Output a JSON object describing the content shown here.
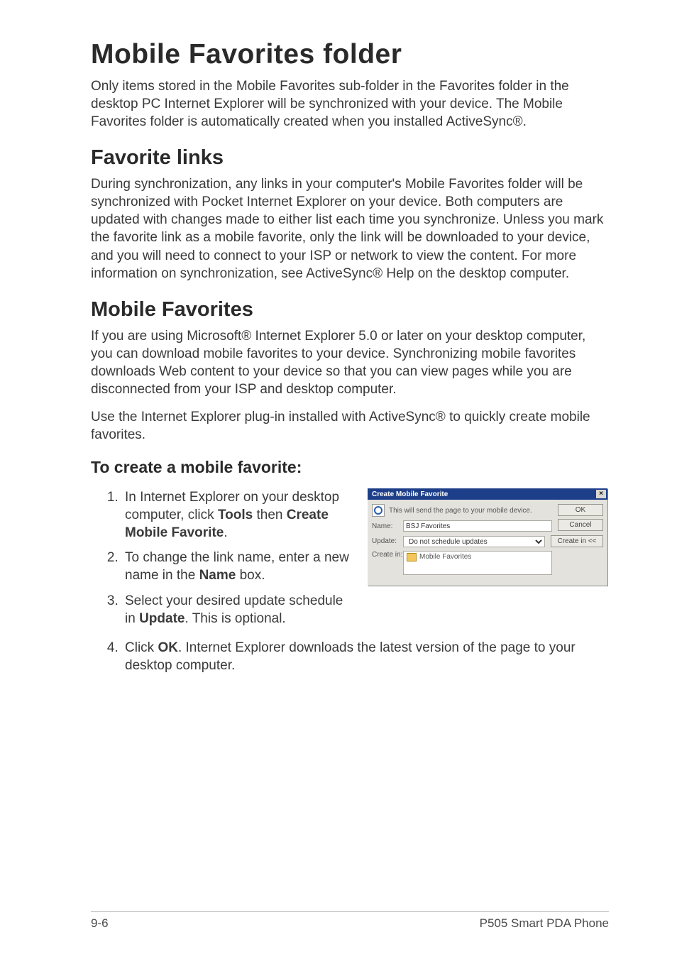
{
  "title": "Mobile Favorites folder",
  "intro": "Only items stored in the Mobile Favorites sub-folder in the Favorites folder in the desktop PC Internet Explorer will be synchronized with your device. The Mobile Favorites folder is automatically created when you installed ActiveSync®.",
  "section1": {
    "heading": "Favorite links",
    "body": "During synchronization, any links in your computer's Mobile Favorites folder will be synchronized with Pocket Internet Explorer on your device. Both computers are updated with changes made to either list each time you synchronize. Unless you mark the favorite link as a mobile favorite, only the link will be downloaded to your device, and you will need to connect to your ISP or network to view the content. For more information on synchronization, see ActiveSync® Help on the desktop computer."
  },
  "section2": {
    "heading": "Mobile Favorites",
    "body1": "If you are using Microsoft® Internet Explorer 5.0 or later on your desktop computer, you can download mobile favorites to your device. Synchronizing mobile favorites downloads Web content to your device so that you can view pages while you are disconnected from your ISP and desktop computer.",
    "body2": "Use the Internet Explorer plug-in installed with ActiveSync® to quickly create mobile favorites."
  },
  "subsection": {
    "heading": "To create a mobile favorite:",
    "steps": [
      {
        "pre": "In Internet Explorer on your desktop computer, click ",
        "b1": "Tools",
        "mid": " then ",
        "b2": "Create Mobile Favorite",
        "post": "."
      },
      {
        "pre": "To change the link name, enter a new name in the ",
        "b1": "Name",
        "post": " box."
      },
      {
        "pre": "Select your desired update schedule in ",
        "b1": "Update",
        "post": ". This is optional."
      },
      {
        "pre": "Click ",
        "b1": "OK",
        "post": ". Internet Explorer downloads the latest version of the page to your desktop computer."
      }
    ]
  },
  "dialog": {
    "title": "Create Mobile Favorite",
    "desc": "This will send the page to your mobile device.",
    "ok": "OK",
    "cancel": "Cancel",
    "name_label": "Name:",
    "name_value": "BSJ Favorites",
    "update_label": "Update:",
    "update_value": "Do not schedule updates",
    "create_in_btn": "Create in <<",
    "create_in_label": "Create in:",
    "tree_item": "Mobile Favorites"
  },
  "footer": {
    "left": "9-6",
    "right": "P505 Smart PDA Phone"
  }
}
